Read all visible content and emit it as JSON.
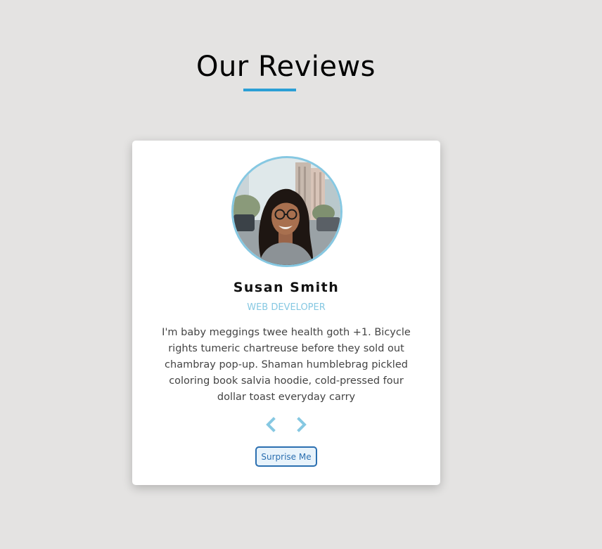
{
  "header": {
    "title": "Our Reviews"
  },
  "review": {
    "name": "Susan Smith",
    "job": "WEB DEVELOPER",
    "text": "I'm baby meggings twee health goth +1. Bicycle rights tumeric chartreuse before they sold out chambray pop-up. Shaman humblebrag pickled coloring book salvia hoodie, cold-pressed four dollar toast everyday carry",
    "avatar_icon": "person-photo"
  },
  "controls": {
    "prev_icon": "chevron-left-icon",
    "next_icon": "chevron-right-icon",
    "surprise_label": "Surprise Me"
  },
  "colors": {
    "background": "#e4e3e2",
    "accent": "#2b9fd6",
    "light_accent": "#86c8e2",
    "button_border": "#2b6fb0"
  }
}
